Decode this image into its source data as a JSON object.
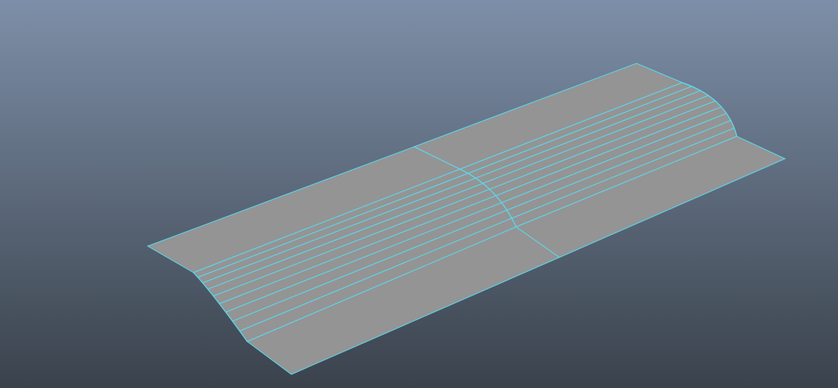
{
  "viewport": {
    "background_top_color": "#7d8fa8",
    "background_bottom_color": "#3a424c",
    "object": {
      "type": "polygon-mesh",
      "surface_color": "#949494",
      "wireframe_color": "#5ad8ee",
      "flat_panel_count": 4,
      "curved_segment_count": 2,
      "curve_subdivisions": 9
    }
  }
}
